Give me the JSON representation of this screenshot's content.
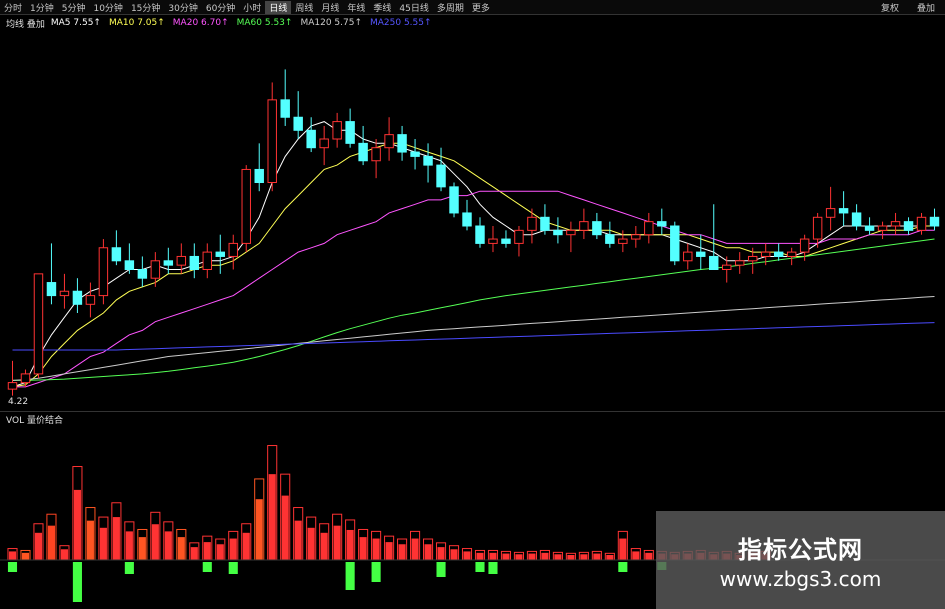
{
  "toolbar": {
    "items": [
      "分时",
      "1分钟",
      "5分钟",
      "10分钟",
      "15分钟",
      "30分钟",
      "60分钟",
      "小时",
      "日线",
      "周线",
      "月线",
      "年线",
      "季线",
      "45日线",
      "多周期",
      "更多"
    ],
    "active_index": 8,
    "right": [
      "复权",
      "叠加"
    ]
  },
  "info": {
    "symbol": "均线 叠加",
    "ma": [
      {
        "label": "MA5",
        "value": "7.55",
        "color": "#ffffff"
      },
      {
        "label": "MA10",
        "value": "7.05",
        "color": "#ffff55"
      },
      {
        "label": "MA20",
        "value": "6.70",
        "color": "#ff55ff"
      },
      {
        "label": "MA60",
        "value": "5.53",
        "color": "#55ff55"
      },
      {
        "label": "MA120",
        "value": "5.75",
        "color": "#cccccc"
      },
      {
        "label": "MA250",
        "value": "5.55",
        "color": "#5555ff"
      }
    ]
  },
  "main_chart": {
    "low_label": "4.22",
    "ymin": 4.0,
    "ymax": 12.0,
    "candles": [
      [
        4.25,
        4.9,
        4.1,
        4.4
      ],
      [
        4.4,
        4.7,
        4.3,
        4.6
      ],
      [
        4.6,
        6.9,
        4.5,
        6.9
      ],
      [
        6.7,
        7.6,
        6.2,
        6.4
      ],
      [
        6.4,
        6.9,
        6.1,
        6.5
      ],
      [
        6.5,
        6.8,
        6.0,
        6.2
      ],
      [
        6.2,
        6.7,
        5.9,
        6.4
      ],
      [
        6.4,
        7.7,
        6.2,
        7.5
      ],
      [
        7.5,
        7.9,
        7.1,
        7.2
      ],
      [
        7.2,
        7.6,
        6.9,
        7.0
      ],
      [
        7.0,
        7.3,
        6.6,
        6.8
      ],
      [
        6.8,
        7.4,
        6.6,
        7.2
      ],
      [
        7.2,
        7.5,
        6.9,
        7.1
      ],
      [
        7.1,
        7.6,
        6.9,
        7.3
      ],
      [
        7.3,
        7.6,
        6.8,
        7.0
      ],
      [
        7.0,
        7.6,
        6.8,
        7.4
      ],
      [
        7.4,
        7.8,
        6.9,
        7.3
      ],
      [
        7.3,
        7.8,
        7.0,
        7.6
      ],
      [
        7.6,
        9.4,
        7.4,
        9.3
      ],
      [
        9.3,
        9.9,
        8.8,
        9.0
      ],
      [
        9.0,
        11.3,
        8.8,
        10.9
      ],
      [
        10.9,
        11.6,
        10.3,
        10.5
      ],
      [
        10.5,
        11.1,
        10.0,
        10.2
      ],
      [
        10.2,
        10.5,
        9.7,
        9.8
      ],
      [
        9.8,
        10.3,
        9.4,
        10.0
      ],
      [
        10.0,
        10.6,
        9.8,
        10.4
      ],
      [
        10.4,
        10.7,
        9.8,
        9.9
      ],
      [
        9.9,
        10.3,
        9.4,
        9.5
      ],
      [
        9.5,
        10.0,
        9.1,
        9.8
      ],
      [
        9.8,
        10.5,
        9.5,
        10.1
      ],
      [
        10.1,
        10.3,
        9.5,
        9.7
      ],
      [
        9.7,
        10.0,
        9.3,
        9.6
      ],
      [
        9.6,
        9.9,
        9.0,
        9.4
      ],
      [
        9.4,
        9.8,
        8.8,
        8.9
      ],
      [
        8.9,
        9.0,
        8.2,
        8.3
      ],
      [
        8.3,
        8.6,
        7.9,
        8.0
      ],
      [
        8.0,
        8.2,
        7.5,
        7.6
      ],
      [
        7.6,
        8.0,
        7.4,
        7.7
      ],
      [
        7.7,
        7.9,
        7.5,
        7.6
      ],
      [
        7.6,
        8.0,
        7.3,
        7.9
      ],
      [
        7.9,
        8.4,
        7.6,
        8.2
      ],
      [
        8.2,
        8.5,
        7.8,
        7.9
      ],
      [
        7.9,
        8.2,
        7.6,
        7.8
      ],
      [
        7.8,
        8.1,
        7.4,
        7.9
      ],
      [
        7.9,
        8.4,
        7.7,
        8.1
      ],
      [
        8.1,
        8.3,
        7.7,
        7.8
      ],
      [
        7.8,
        8.1,
        7.5,
        7.6
      ],
      [
        7.6,
        7.9,
        7.4,
        7.7
      ],
      [
        7.7,
        8.0,
        7.5,
        7.8
      ],
      [
        7.8,
        8.3,
        7.6,
        8.1
      ],
      [
        8.1,
        8.4,
        7.8,
        8.0
      ],
      [
        8.0,
        8.1,
        7.1,
        7.2
      ],
      [
        7.2,
        7.6,
        7.0,
        7.4
      ],
      [
        7.4,
        7.8,
        7.0,
        7.3
      ],
      [
        7.3,
        8.5,
        7.0,
        7.0
      ],
      [
        7.0,
        7.3,
        6.7,
        7.1
      ],
      [
        7.1,
        7.4,
        6.9,
        7.2
      ],
      [
        7.2,
        7.5,
        6.9,
        7.3
      ],
      [
        7.3,
        7.6,
        7.1,
        7.4
      ],
      [
        7.4,
        7.6,
        7.2,
        7.3
      ],
      [
        7.3,
        7.5,
        7.1,
        7.4
      ],
      [
        7.4,
        7.8,
        7.2,
        7.7
      ],
      [
        7.7,
        8.3,
        7.5,
        8.2
      ],
      [
        8.2,
        8.9,
        7.9,
        8.4
      ],
      [
        8.4,
        8.8,
        8.0,
        8.3
      ],
      [
        8.3,
        8.5,
        7.9,
        8.0
      ],
      [
        8.0,
        8.2,
        7.8,
        7.9
      ],
      [
        7.9,
        8.1,
        7.7,
        8.0
      ],
      [
        8.0,
        8.3,
        7.8,
        8.1
      ],
      [
        8.1,
        8.2,
        7.8,
        7.9
      ],
      [
        7.9,
        8.3,
        7.8,
        8.2
      ],
      [
        8.2,
        8.4,
        7.9,
        8.0
      ]
    ],
    "ma_lines": [
      {
        "name": "MA5",
        "color": "#ffffff",
        "values": [
          4.3,
          4.4,
          5.0,
          5.5,
          5.9,
          6.3,
          6.5,
          6.6,
          6.8,
          7.0,
          7.0,
          7.1,
          7.0,
          7.0,
          7.1,
          7.2,
          7.2,
          7.3,
          7.7,
          8.2,
          9.0,
          9.6,
          10.0,
          10.3,
          10.4,
          10.2,
          10.2,
          10.0,
          9.9,
          9.9,
          9.8,
          9.7,
          9.6,
          9.5,
          9.2,
          8.9,
          8.5,
          8.2,
          8.0,
          7.8,
          7.8,
          7.9,
          7.9,
          7.9,
          7.9,
          7.9,
          7.8,
          7.8,
          7.8,
          7.8,
          7.8,
          7.7,
          7.6,
          7.5,
          7.4,
          7.2,
          7.2,
          7.2,
          7.3,
          7.3,
          7.3,
          7.4,
          7.6,
          7.8,
          8.0,
          8.0,
          8.0,
          8.0,
          8.0,
          8.0,
          8.0,
          8.0
        ]
      },
      {
        "name": "MA10",
        "color": "#ffff55",
        "values": [
          4.3,
          4.35,
          4.6,
          5.0,
          5.3,
          5.6,
          5.8,
          6.0,
          6.3,
          6.5,
          6.6,
          6.7,
          6.9,
          6.9,
          7.0,
          7.1,
          7.1,
          7.2,
          7.4,
          7.6,
          8.0,
          8.4,
          8.7,
          9.0,
          9.3,
          9.4,
          9.6,
          9.7,
          9.8,
          9.9,
          9.9,
          9.8,
          9.7,
          9.6,
          9.5,
          9.3,
          9.1,
          8.9,
          8.7,
          8.5,
          8.3,
          8.1,
          8.0,
          7.9,
          7.9,
          7.9,
          7.9,
          7.8,
          7.8,
          7.8,
          7.8,
          7.8,
          7.8,
          7.7,
          7.6,
          7.5,
          7.5,
          7.4,
          7.4,
          7.4,
          7.3,
          7.3,
          7.4,
          7.5,
          7.6,
          7.7,
          7.8,
          7.9,
          7.9,
          7.9,
          8.0,
          8.0
        ]
      },
      {
        "name": "MA20",
        "color": "#ff55ff",
        "values": [
          4.3,
          4.3,
          4.4,
          4.5,
          4.6,
          4.8,
          5.0,
          5.1,
          5.3,
          5.5,
          5.6,
          5.8,
          5.9,
          6.0,
          6.1,
          6.2,
          6.3,
          6.4,
          6.6,
          6.8,
          7.0,
          7.2,
          7.4,
          7.5,
          7.6,
          7.8,
          7.9,
          8.0,
          8.1,
          8.3,
          8.4,
          8.5,
          8.6,
          8.6,
          8.7,
          8.7,
          8.8,
          8.8,
          8.8,
          8.8,
          8.8,
          8.8,
          8.8,
          8.7,
          8.6,
          8.5,
          8.4,
          8.3,
          8.2,
          8.1,
          8.0,
          7.9,
          7.8,
          7.8,
          7.7,
          7.6,
          7.6,
          7.6,
          7.6,
          7.6,
          7.6,
          7.6,
          7.6,
          7.7,
          7.7,
          7.7,
          7.8,
          7.8,
          7.8,
          7.8,
          7.9,
          7.9
        ]
      },
      {
        "name": "MA60",
        "color": "#55ff55",
        "values": [
          4.45,
          4.45,
          4.46,
          4.47,
          4.48,
          4.5,
          4.52,
          4.54,
          4.56,
          4.58,
          4.6,
          4.63,
          4.66,
          4.7,
          4.74,
          4.78,
          4.82,
          4.87,
          4.93,
          5.0,
          5.08,
          5.16,
          5.25,
          5.35,
          5.45,
          5.55,
          5.64,
          5.72,
          5.8,
          5.88,
          5.95,
          6.0,
          6.06,
          6.12,
          6.18,
          6.24,
          6.3,
          6.35,
          6.4,
          6.44,
          6.48,
          6.52,
          6.56,
          6.6,
          6.64,
          6.68,
          6.72,
          6.76,
          6.8,
          6.84,
          6.88,
          6.92,
          6.96,
          7.0,
          7.03,
          7.06,
          7.1,
          7.14,
          7.18,
          7.22,
          7.26,
          7.3,
          7.34,
          7.38,
          7.42,
          7.46,
          7.5,
          7.54,
          7.58,
          7.62,
          7.66,
          7.7
        ]
      },
      {
        "name": "MA120",
        "color": "#cccccc",
        "values": [
          4.45,
          4.47,
          4.5,
          4.55,
          4.6,
          4.65,
          4.7,
          4.75,
          4.8,
          4.85,
          4.9,
          4.95,
          5.0,
          5.03,
          5.06,
          5.09,
          5.12,
          5.15,
          5.18,
          5.21,
          5.24,
          5.27,
          5.3,
          5.33,
          5.36,
          5.39,
          5.42,
          5.45,
          5.48,
          5.51,
          5.54,
          5.57,
          5.6,
          5.62,
          5.64,
          5.66,
          5.68,
          5.7,
          5.72,
          5.74,
          5.76,
          5.78,
          5.8,
          5.82,
          5.84,
          5.86,
          5.88,
          5.9,
          5.92,
          5.94,
          5.96,
          5.98,
          6.0,
          6.02,
          6.04,
          6.06,
          6.08,
          6.1,
          6.12,
          6.14,
          6.16,
          6.18,
          6.2,
          6.22,
          6.24,
          6.26,
          6.28,
          6.3,
          6.32,
          6.34,
          6.36,
          6.38
        ]
      },
      {
        "name": "MA250",
        "color": "#4b4bff",
        "values": [
          5.15,
          5.15,
          5.15,
          5.15,
          5.15,
          5.15,
          5.15,
          5.15,
          5.15,
          5.16,
          5.17,
          5.18,
          5.19,
          5.2,
          5.21,
          5.22,
          5.23,
          5.24,
          5.25,
          5.26,
          5.27,
          5.28,
          5.29,
          5.3,
          5.31,
          5.32,
          5.33,
          5.34,
          5.35,
          5.36,
          5.37,
          5.38,
          5.39,
          5.4,
          5.41,
          5.42,
          5.43,
          5.44,
          5.45,
          5.46,
          5.47,
          5.48,
          5.49,
          5.5,
          5.51,
          5.52,
          5.53,
          5.54,
          5.55,
          5.56,
          5.57,
          5.58,
          5.59,
          5.6,
          5.61,
          5.62,
          5.63,
          5.64,
          5.65,
          5.66,
          5.67,
          5.68,
          5.69,
          5.7,
          5.71,
          5.72,
          5.73,
          5.74,
          5.75,
          5.76,
          5.77,
          5.78
        ]
      }
    ]
  },
  "sub_chart": {
    "label": "VOL 量价结合",
    "ymax": 130,
    "bars": [
      [
        12,
        "#ff3333"
      ],
      [
        10,
        "#ff5522"
      ],
      [
        38,
        "#ff3333"
      ],
      [
        48,
        "#ff4422"
      ],
      [
        15,
        "#ff3333"
      ],
      [
        98,
        "#ff3333"
      ],
      [
        55,
        "#ff5522"
      ],
      [
        45,
        "#ff3333"
      ],
      [
        60,
        "#ff3333"
      ],
      [
        40,
        "#ff3333"
      ],
      [
        32,
        "#ff5522"
      ],
      [
        50,
        "#ff3333"
      ],
      [
        40,
        "#ff3333"
      ],
      [
        32,
        "#ff5522"
      ],
      [
        18,
        "#ff3333"
      ],
      [
        25,
        "#ff3333"
      ],
      [
        22,
        "#ff3333"
      ],
      [
        30,
        "#ff3333"
      ],
      [
        38,
        "#ff3333"
      ],
      [
        85,
        "#ff5522"
      ],
      [
        120,
        "#ff3333"
      ],
      [
        90,
        "#ff3333"
      ],
      [
        55,
        "#ff3333"
      ],
      [
        45,
        "#ff3333"
      ],
      [
        38,
        "#ff3333"
      ],
      [
        48,
        "#ff3333"
      ],
      [
        42,
        "#ff3333"
      ],
      [
        32,
        "#ff3333"
      ],
      [
        30,
        "#ff3333"
      ],
      [
        25,
        "#ff3333"
      ],
      [
        22,
        "#ff3333"
      ],
      [
        30,
        "#ff3333"
      ],
      [
        22,
        "#ff3333"
      ],
      [
        18,
        "#ff3333"
      ],
      [
        15,
        "#ff3333"
      ],
      [
        12,
        "#ff3333"
      ],
      [
        10,
        "#ff3333"
      ],
      [
        10,
        "#ff3333"
      ],
      [
        9,
        "#ff3333"
      ],
      [
        8,
        "#ff3333"
      ],
      [
        9,
        "#ff3333"
      ],
      [
        10,
        "#ff3333"
      ],
      [
        8,
        "#ff3333"
      ],
      [
        7,
        "#ff3333"
      ],
      [
        8,
        "#ff3333"
      ],
      [
        9,
        "#ff3333"
      ],
      [
        7,
        "#ff3333"
      ],
      [
        30,
        "#ff3333"
      ],
      [
        12,
        "#ff3333"
      ],
      [
        10,
        "#ff3333"
      ],
      [
        9,
        "#ff3333"
      ],
      [
        8,
        "#ff3333"
      ],
      [
        9,
        "#ff3333"
      ],
      [
        10,
        "#ff3333"
      ],
      [
        8,
        "#ff3333"
      ],
      [
        9,
        "#ff3333"
      ],
      [
        7,
        "#ff3333"
      ],
      [
        8,
        "#ff3333"
      ],
      [
        9,
        "#ff3333"
      ]
    ],
    "neg": [
      [
        0,
        10
      ],
      [
        5,
        40
      ],
      [
        9,
        12
      ],
      [
        15,
        10
      ],
      [
        17,
        12
      ],
      [
        26,
        28
      ],
      [
        28,
        20
      ],
      [
        33,
        15
      ],
      [
        36,
        10
      ],
      [
        37,
        12
      ],
      [
        47,
        10
      ],
      [
        50,
        8
      ]
    ]
  },
  "watermark": {
    "line1": "指标公式网",
    "line2": "www.zbgs3.com"
  }
}
